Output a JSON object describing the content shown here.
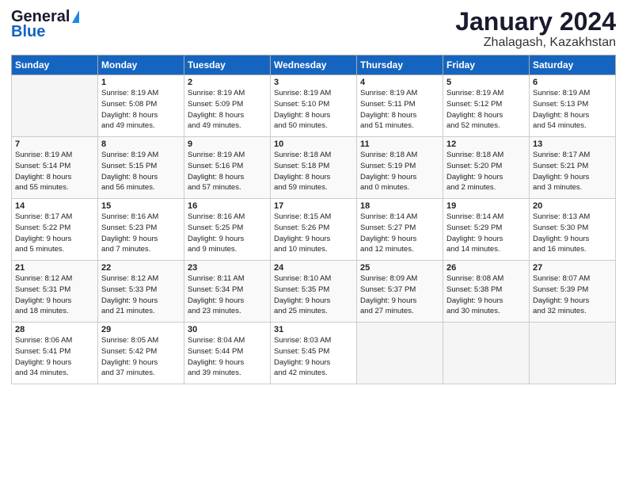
{
  "logo": {
    "general": "General",
    "blue": "Blue"
  },
  "title": "January 2024",
  "location": "Zhalagash, Kazakhstan",
  "days_of_week": [
    "Sunday",
    "Monday",
    "Tuesday",
    "Wednesday",
    "Thursday",
    "Friday",
    "Saturday"
  ],
  "weeks": [
    [
      {
        "num": "",
        "info": ""
      },
      {
        "num": "1",
        "info": "Sunrise: 8:19 AM\nSunset: 5:08 PM\nDaylight: 8 hours\nand 49 minutes."
      },
      {
        "num": "2",
        "info": "Sunrise: 8:19 AM\nSunset: 5:09 PM\nDaylight: 8 hours\nand 49 minutes."
      },
      {
        "num": "3",
        "info": "Sunrise: 8:19 AM\nSunset: 5:10 PM\nDaylight: 8 hours\nand 50 minutes."
      },
      {
        "num": "4",
        "info": "Sunrise: 8:19 AM\nSunset: 5:11 PM\nDaylight: 8 hours\nand 51 minutes."
      },
      {
        "num": "5",
        "info": "Sunrise: 8:19 AM\nSunset: 5:12 PM\nDaylight: 8 hours\nand 52 minutes."
      },
      {
        "num": "6",
        "info": "Sunrise: 8:19 AM\nSunset: 5:13 PM\nDaylight: 8 hours\nand 54 minutes."
      }
    ],
    [
      {
        "num": "7",
        "info": "Sunrise: 8:19 AM\nSunset: 5:14 PM\nDaylight: 8 hours\nand 55 minutes."
      },
      {
        "num": "8",
        "info": "Sunrise: 8:19 AM\nSunset: 5:15 PM\nDaylight: 8 hours\nand 56 minutes."
      },
      {
        "num": "9",
        "info": "Sunrise: 8:19 AM\nSunset: 5:16 PM\nDaylight: 8 hours\nand 57 minutes."
      },
      {
        "num": "10",
        "info": "Sunrise: 8:18 AM\nSunset: 5:18 PM\nDaylight: 8 hours\nand 59 minutes."
      },
      {
        "num": "11",
        "info": "Sunrise: 8:18 AM\nSunset: 5:19 PM\nDaylight: 9 hours\nand 0 minutes."
      },
      {
        "num": "12",
        "info": "Sunrise: 8:18 AM\nSunset: 5:20 PM\nDaylight: 9 hours\nand 2 minutes."
      },
      {
        "num": "13",
        "info": "Sunrise: 8:17 AM\nSunset: 5:21 PM\nDaylight: 9 hours\nand 3 minutes."
      }
    ],
    [
      {
        "num": "14",
        "info": "Sunrise: 8:17 AM\nSunset: 5:22 PM\nDaylight: 9 hours\nand 5 minutes."
      },
      {
        "num": "15",
        "info": "Sunrise: 8:16 AM\nSunset: 5:23 PM\nDaylight: 9 hours\nand 7 minutes."
      },
      {
        "num": "16",
        "info": "Sunrise: 8:16 AM\nSunset: 5:25 PM\nDaylight: 9 hours\nand 9 minutes."
      },
      {
        "num": "17",
        "info": "Sunrise: 8:15 AM\nSunset: 5:26 PM\nDaylight: 9 hours\nand 10 minutes."
      },
      {
        "num": "18",
        "info": "Sunrise: 8:14 AM\nSunset: 5:27 PM\nDaylight: 9 hours\nand 12 minutes."
      },
      {
        "num": "19",
        "info": "Sunrise: 8:14 AM\nSunset: 5:29 PM\nDaylight: 9 hours\nand 14 minutes."
      },
      {
        "num": "20",
        "info": "Sunrise: 8:13 AM\nSunset: 5:30 PM\nDaylight: 9 hours\nand 16 minutes."
      }
    ],
    [
      {
        "num": "21",
        "info": "Sunrise: 8:12 AM\nSunset: 5:31 PM\nDaylight: 9 hours\nand 18 minutes."
      },
      {
        "num": "22",
        "info": "Sunrise: 8:12 AM\nSunset: 5:33 PM\nDaylight: 9 hours\nand 21 minutes."
      },
      {
        "num": "23",
        "info": "Sunrise: 8:11 AM\nSunset: 5:34 PM\nDaylight: 9 hours\nand 23 minutes."
      },
      {
        "num": "24",
        "info": "Sunrise: 8:10 AM\nSunset: 5:35 PM\nDaylight: 9 hours\nand 25 minutes."
      },
      {
        "num": "25",
        "info": "Sunrise: 8:09 AM\nSunset: 5:37 PM\nDaylight: 9 hours\nand 27 minutes."
      },
      {
        "num": "26",
        "info": "Sunrise: 8:08 AM\nSunset: 5:38 PM\nDaylight: 9 hours\nand 30 minutes."
      },
      {
        "num": "27",
        "info": "Sunrise: 8:07 AM\nSunset: 5:39 PM\nDaylight: 9 hours\nand 32 minutes."
      }
    ],
    [
      {
        "num": "28",
        "info": "Sunrise: 8:06 AM\nSunset: 5:41 PM\nDaylight: 9 hours\nand 34 minutes."
      },
      {
        "num": "29",
        "info": "Sunrise: 8:05 AM\nSunset: 5:42 PM\nDaylight: 9 hours\nand 37 minutes."
      },
      {
        "num": "30",
        "info": "Sunrise: 8:04 AM\nSunset: 5:44 PM\nDaylight: 9 hours\nand 39 minutes."
      },
      {
        "num": "31",
        "info": "Sunrise: 8:03 AM\nSunset: 5:45 PM\nDaylight: 9 hours\nand 42 minutes."
      },
      {
        "num": "",
        "info": ""
      },
      {
        "num": "",
        "info": ""
      },
      {
        "num": "",
        "info": ""
      }
    ]
  ]
}
